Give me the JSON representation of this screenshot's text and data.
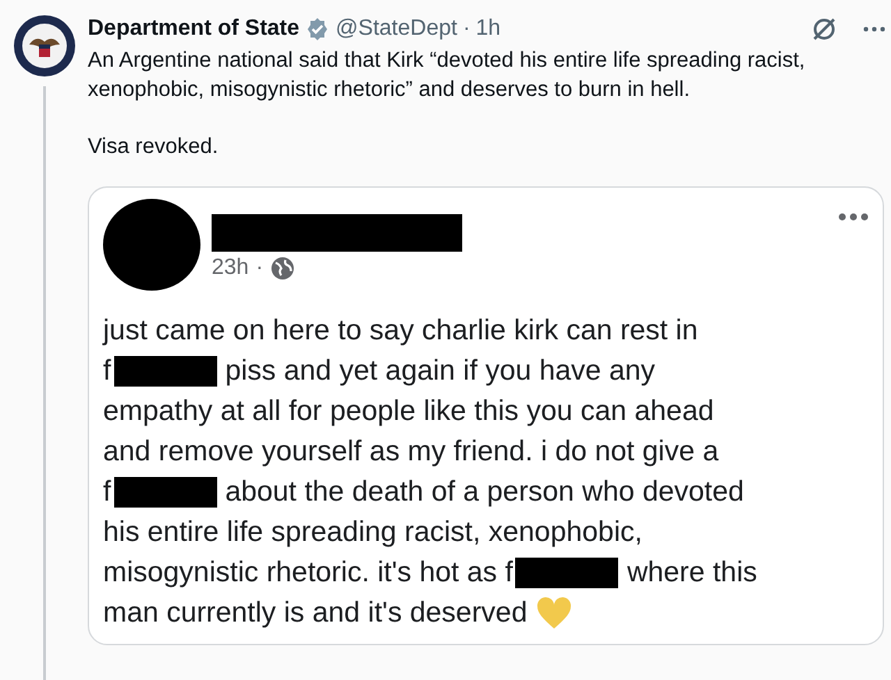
{
  "tweet": {
    "author": "Department of State",
    "handle": "@StateDept",
    "separator": "·",
    "time": "1h",
    "verified": true,
    "text": [
      "An Argentine national said that Kirk “devoted his entire life spreading racist, xenophobic, misogynistic rhetoric” and deserves to burn in hell.",
      "Visa revoked."
    ]
  },
  "embedded_post": {
    "time": "23h",
    "separator": "·",
    "lines": [
      [
        {
          "kind": "text",
          "text": "just came on here to say charlie kirk can rest in"
        }
      ],
      [
        {
          "kind": "text",
          "text": "f"
        },
        {
          "kind": "redaction"
        },
        {
          "kind": "text",
          "text": "piss and yet again if you have any"
        }
      ],
      [
        {
          "kind": "text",
          "text": "empathy at all for people like this you can ahead"
        }
      ],
      [
        {
          "kind": "text",
          "text": "and remove yourself as my friend. i do not give a"
        }
      ],
      [
        {
          "kind": "text",
          "text": "f"
        },
        {
          "kind": "redaction"
        },
        {
          "kind": "text",
          "text": "about the death of a person who devoted"
        }
      ],
      [
        {
          "kind": "text",
          "text": "his entire life spreading racist, xenophobic,"
        }
      ],
      [
        {
          "kind": "text",
          "text": "misogynistic rhetoric. it's hot as f"
        },
        {
          "kind": "redaction"
        },
        {
          "kind": "text",
          "text": "where this"
        }
      ],
      [
        {
          "kind": "text",
          "text": "man currently is and it's deserved"
        },
        {
          "kind": "heart",
          "color": "#f2c94c"
        }
      ]
    ]
  }
}
